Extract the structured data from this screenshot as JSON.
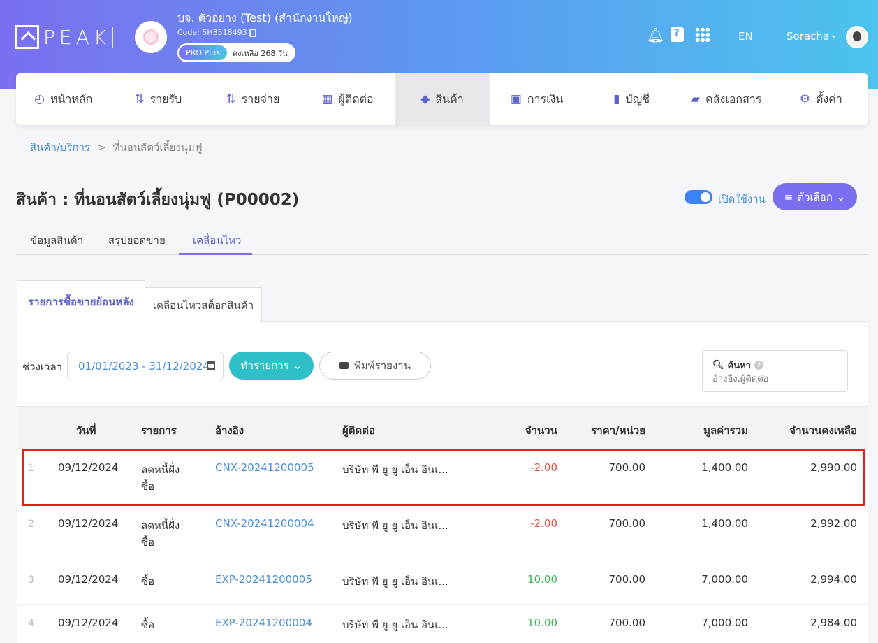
{
  "header": {
    "logo_text": "PEAK",
    "company_name": "บจ. ตัวอย่าง (Test) (สำนักงานใหญ่)",
    "company_code": "Code: 5H3518493",
    "plan_badge": "PRO Plus",
    "plan_remaining": "คงเหลือ 268 วัน",
    "language": "EN",
    "user_name": "Soracha"
  },
  "nav": {
    "items": [
      {
        "label": "หน้าหลัก",
        "icon": "dashboard-icon"
      },
      {
        "label": "รายรับ",
        "icon": "income-icon"
      },
      {
        "label": "รายจ่าย",
        "icon": "expense-icon"
      },
      {
        "label": "ผู้ติดต่อ",
        "icon": "contacts-icon"
      },
      {
        "label": "สินค้า",
        "icon": "box-icon"
      },
      {
        "label": "การเงิน",
        "icon": "money-icon"
      },
      {
        "label": "บัญชี",
        "icon": "ledger-icon"
      },
      {
        "label": "คลังเอกสาร",
        "icon": "folder-icon"
      },
      {
        "label": "ตั้งค่า",
        "icon": "gear-icon"
      }
    ],
    "active_index": 4
  },
  "breadcrumb": {
    "parent": "สินค้า/บริการ",
    "separator": ">",
    "current": "ที่นอนสัตว์เลี้ยงนุ่มฟู"
  },
  "page": {
    "title": "สินค้า : ที่นอนสัตว์เลี้ยงนุ่มฟู (P00002)",
    "toggle_label": "เปิดใช้งาน",
    "options_label": "ตัวเลือก"
  },
  "subtabs": [
    "ข้อมูลสินค้า",
    "สรุปยอดขาย",
    "เคลื่อนไหว"
  ],
  "card_tabs": [
    "รายการซื้อขายย้อนหลัง",
    "เคลื่อนไหวสต็อกสินค้า"
  ],
  "filters": {
    "period_label": "ช่วงเวลา",
    "date_range": "01/01/2023 - 31/12/2024",
    "action_label": "ทำรายการ",
    "print_label": "พิมพ์รายงาน",
    "search_label": "ค้นหา",
    "search_placeholder": "อ้างอิง,ผู้ติดต่อ"
  },
  "table": {
    "columns": [
      "วันที่",
      "รายการ",
      "อ้างอิง",
      "ผู้ติดต่อ",
      "จำนวน",
      "ราคา/หน่วย",
      "มูลค่ารวม",
      "จำนวนคงเหลือ"
    ],
    "rows": [
      {
        "no": "1",
        "date": "09/12/2024",
        "item": "ลดหนี้ฝั่ง",
        "item2": "ซื้อ",
        "ref": "CNX-20241200005",
        "contact": "บริษัท พี ยู ยู เอ็น อินเ...",
        "qty": "-2.00",
        "price": "700.00",
        "total": "1,400.00",
        "balance": "2,990.00"
      },
      {
        "no": "2",
        "date": "09/12/2024",
        "item": "ลดหนี้ฝั่ง",
        "item2": "ซื้อ",
        "ref": "CNX-20241200004",
        "contact": "บริษัท พี ยู ยู เอ็น อินเ...",
        "qty": "-2.00",
        "price": "700.00",
        "total": "1,400.00",
        "balance": "2,992.00"
      },
      {
        "no": "3",
        "date": "09/12/2024",
        "item": "ซื้อ",
        "item2": "",
        "ref": "EXP-20241200005",
        "contact": "บริษัท พี ยู ยู เอ็น อินเ...",
        "qty": "10.00",
        "price": "700.00",
        "total": "7,000.00",
        "balance": "2,994.00"
      },
      {
        "no": "4",
        "date": "09/12/2024",
        "item": "ซื้อ",
        "item2": "",
        "ref": "EXP-20241200004",
        "contact": "บริษัท พี ยู ยู เอ็น อินเ...",
        "qty": "10.00",
        "price": "700.00",
        "total": "7,000.00",
        "balance": "2,984.00"
      }
    ]
  },
  "colors": {
    "accent": "#7b6ff0",
    "teal": "#2fbfc9",
    "link": "#4a8fd8",
    "negative": "#e5533d",
    "positive": "#3cb65a",
    "highlight": "#ee1c1c"
  }
}
